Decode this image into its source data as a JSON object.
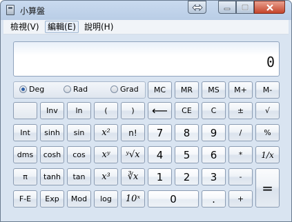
{
  "window": {
    "title": "小算盤"
  },
  "menu": [
    "檢視(V)",
    "編輯(E)",
    "說明(H)"
  ],
  "display": {
    "value": "0"
  },
  "angle_units": {
    "options": [
      "Deg",
      "Rad",
      "Grad"
    ],
    "selected": "Deg"
  },
  "buttons": {
    "mc": "MC",
    "mr": "MR",
    "ms": "MS",
    "mplus": "M+",
    "mminus": "M-",
    "inv": "Inv",
    "ln": "ln",
    "lparen": "(",
    "rparen": ")",
    "backspace": "⟵",
    "ce": "CE",
    "c": "C",
    "plusminus": "±",
    "sqrt": "√",
    "int": "Int",
    "sinh": "sinh",
    "sin": "sin",
    "x2": "x²",
    "factorial": "n!",
    "n7": "7",
    "n8": "8",
    "n9": "9",
    "div": "/",
    "percent": "%",
    "dms": "dms",
    "cosh": "cosh",
    "cos": "cos",
    "xy": "xʸ",
    "yroot": "ʸ√x",
    "n4": "4",
    "n5": "5",
    "n6": "6",
    "mul": "*",
    "recip": "1/x",
    "pi": "π",
    "tanh": "tanh",
    "tan": "tan",
    "x3": "x³",
    "cuberoot": "∛x",
    "n1": "1",
    "n2": "2",
    "n3": "3",
    "minus": "-",
    "equals": "=",
    "fe": "F-E",
    "exp": "Exp",
    "mod": "Mod",
    "log": "log",
    "tenx": "10ˣ",
    "n0": "0",
    "dot": ".",
    "plus": "+"
  }
}
